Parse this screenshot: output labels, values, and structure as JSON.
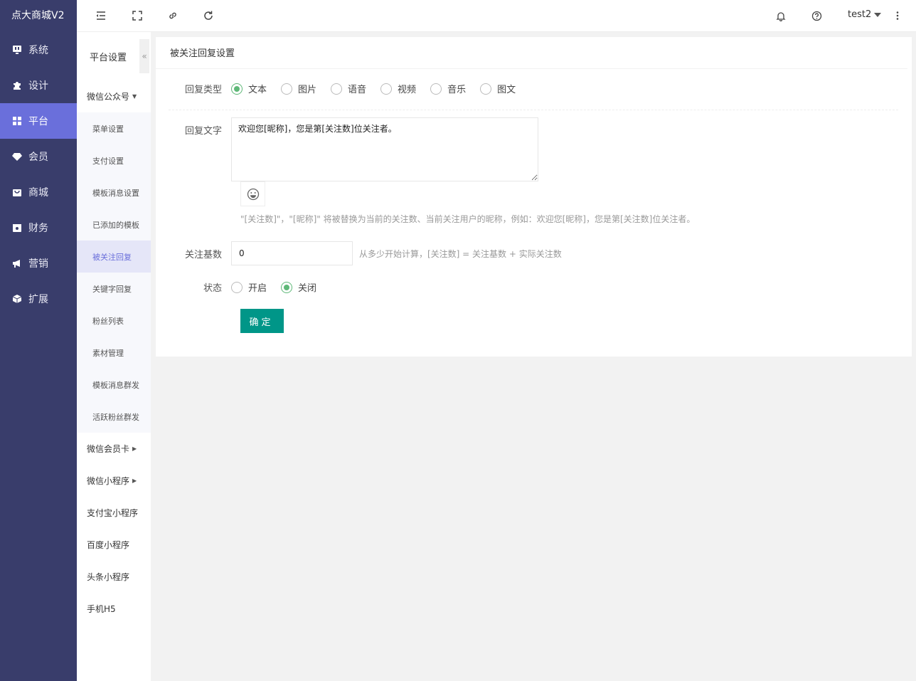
{
  "brand": "点大商城V2",
  "nav": [
    {
      "label": "系统",
      "icon": "monitor-icon"
    },
    {
      "label": "设计",
      "icon": "puzzle-icon"
    },
    {
      "label": "平台",
      "icon": "grid-icon",
      "active": true
    },
    {
      "label": "会员",
      "icon": "diamond-icon"
    },
    {
      "label": "商城",
      "icon": "shop-bag-icon"
    },
    {
      "label": "财务",
      "icon": "wallet-icon"
    },
    {
      "label": "营销",
      "icon": "megaphone-icon"
    },
    {
      "label": "扩展",
      "icon": "cube-icon"
    }
  ],
  "submenu": {
    "title": "平台设置",
    "collapse_glyph": "«",
    "groups": [
      {
        "label": "微信公众号",
        "caret": "▼",
        "children": [
          "菜单设置",
          "支付设置",
          "模板消息设置",
          "已添加的模板",
          "被关注回复",
          "关键字回复",
          "粉丝列表",
          "素材管理",
          "模板消息群发",
          "活跃粉丝群发"
        ]
      },
      {
        "label": "微信会员卡",
        "caret": "▶"
      },
      {
        "label": "微信小程序",
        "caret": "▶"
      },
      {
        "label": "支付宝小程序"
      },
      {
        "label": "百度小程序"
      },
      {
        "label": "头条小程序"
      },
      {
        "label": "手机H5"
      }
    ]
  },
  "topbar": {
    "icons": [
      "menu-fold-icon",
      "fullscreen-icon",
      "link-icon",
      "refresh-icon"
    ],
    "user": "test2",
    "right_icons": [
      "bell-icon",
      "help-icon",
      "more-vertical-icon"
    ]
  },
  "form": {
    "title": "被关注回复设置",
    "reply_type": {
      "label": "回复类型",
      "options": [
        "文本",
        "图片",
        "语音",
        "视频",
        "音乐",
        "图文"
      ],
      "selected": "文本"
    },
    "reply_text": {
      "label": "回复文字",
      "value": "欢迎您[昵称]，您是第[关注数]位关注者。"
    },
    "hint": "\"[关注数]\"，\"[昵称]\" 将被替换为当前的关注数、当前关注用户的昵称，例如：欢迎您[昵称]，您是第[关注数]位关注者。",
    "follow_base": {
      "label": "关注基数",
      "value": "0",
      "aux": "从多少开始计算，[关注数] = 关注基数 + 实际关注数"
    },
    "status": {
      "label": "状态",
      "options": [
        "开启",
        "关闭"
      ],
      "selected": "关闭"
    },
    "submit": "确定"
  },
  "colors": {
    "nav_bg": "#393d6b",
    "nav_active": "#6a6fdb",
    "radio_on": "#5fb878",
    "primary_button": "#009688"
  }
}
